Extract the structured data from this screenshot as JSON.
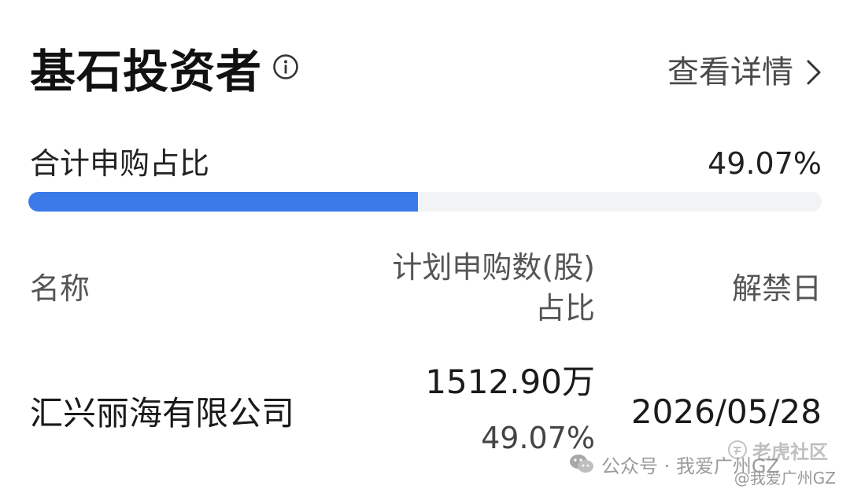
{
  "header": {
    "title": "基石投资者",
    "info_icon": "info-circle-icon",
    "detail_label": "查看详情",
    "detail_icon": "chevron-right-icon"
  },
  "summary": {
    "label": "合计申购占比",
    "value": "49.07%",
    "progress_fraction": 0.4907,
    "progress_color": "#3b7be9",
    "track_color": "#f2f3f5"
  },
  "table": {
    "columns": {
      "name": "名称",
      "plan_line1": "计划申购数(股)",
      "plan_line2": "占比",
      "unlock_date": "解禁日"
    },
    "rows": [
      {
        "name": "汇兴丽海有限公司",
        "shares": "1512.90万",
        "ratio": "49.07%",
        "unlock_date": "2026/05/28"
      }
    ]
  },
  "watermarks": {
    "wechat_text": "公众号 · 我爱广州GZ",
    "tiger_text": "老虎社区",
    "handle_text": "@我爱广州GZ"
  }
}
